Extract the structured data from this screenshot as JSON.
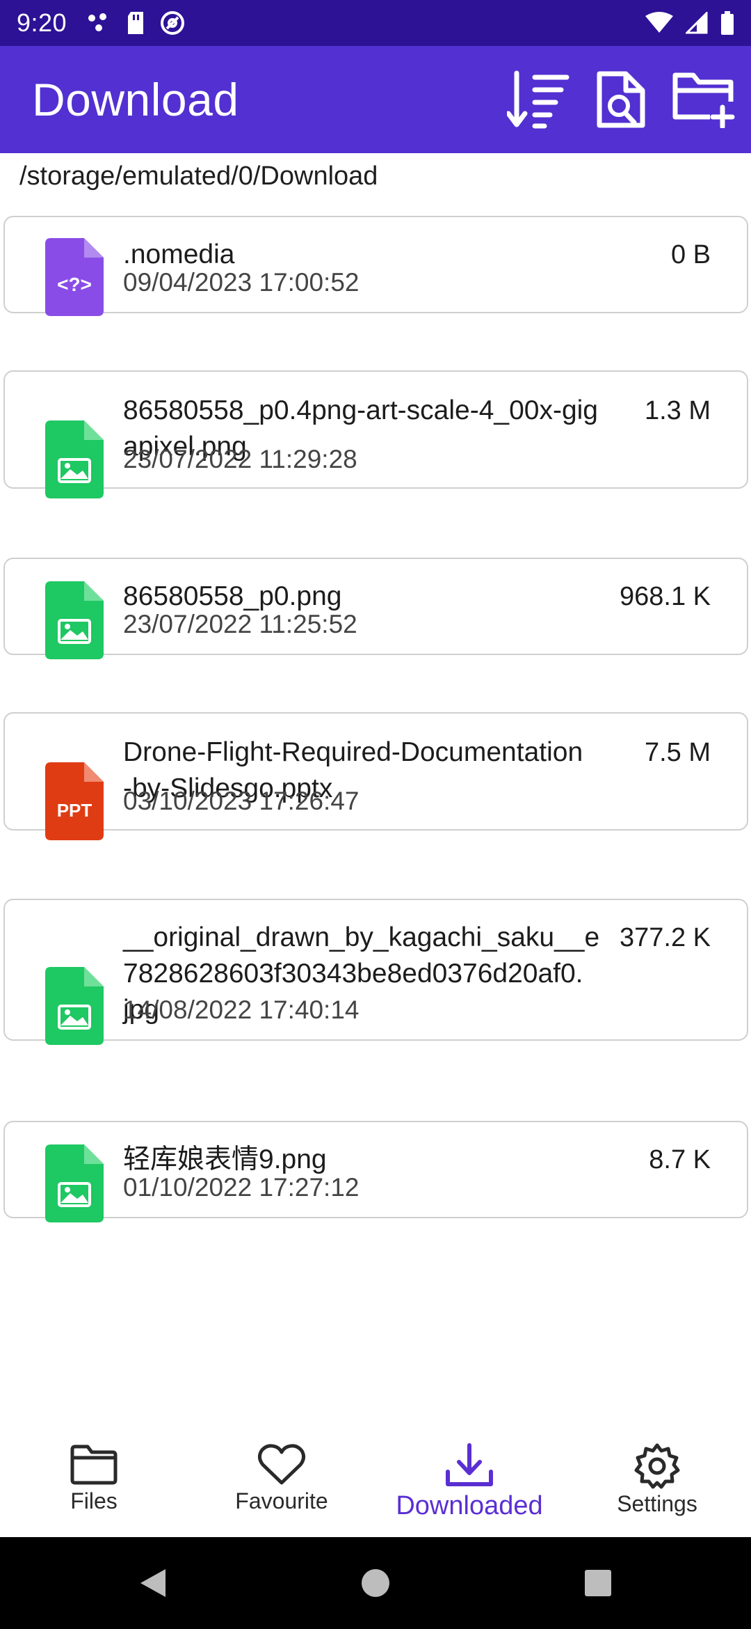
{
  "status_bar": {
    "time": "9:20"
  },
  "app_bar": {
    "title": "Download",
    "actions": [
      "sort-icon",
      "search-file-icon",
      "new-folder-icon"
    ]
  },
  "path": "/storage/emulated/0/Download",
  "colors": {
    "status_bar": "#2d1296",
    "app_bar": "#5230d2",
    "accent": "#5a2fd2",
    "unknown_file": "#8a4ce6",
    "image_file": "#1ec862",
    "ppt_file": "#e03c14"
  },
  "files": [
    {
      "name": ".nomedia",
      "date": "09/04/2023 17:00:52",
      "size": "0 B",
      "type": "unknown",
      "icon_label": "<?>"
    },
    {
      "name": "86580558_p0.4png-art-scale-4_00x-gig\napixel.png",
      "date": "23/07/2022 11:29:28",
      "size": "1.3 M",
      "type": "image",
      "icon_label": ""
    },
    {
      "name": "86580558_p0.png",
      "date": "23/07/2022 11:25:52",
      "size": "968.1 K",
      "type": "image",
      "icon_label": ""
    },
    {
      "name": "Drone-Flight-Required-Documentation\n-by-Slidesgo.pptx",
      "date": "03/10/2023 17:26:47",
      "size": "7.5 M",
      "type": "ppt",
      "icon_label": "PPT"
    },
    {
      "name": "__original_drawn_by_kagachi_saku__e\n7828628603f30343be8ed0376d20af0.\njpg",
      "date": "14/08/2022 17:40:14",
      "size": "377.2 K",
      "type": "image",
      "icon_label": ""
    },
    {
      "name": "轻库娘表情9.png",
      "date": "01/10/2022 17:27:12",
      "size": "8.7 K",
      "type": "image",
      "icon_label": ""
    }
  ],
  "bottom_nav": [
    {
      "label": "Files",
      "icon": "folder-icon",
      "active": false
    },
    {
      "label": "Favourite",
      "icon": "heart-icon",
      "active": false
    },
    {
      "label": "Downloaded",
      "icon": "download-icon",
      "active": true
    },
    {
      "label": "Settings",
      "icon": "gear-icon",
      "active": false
    }
  ]
}
